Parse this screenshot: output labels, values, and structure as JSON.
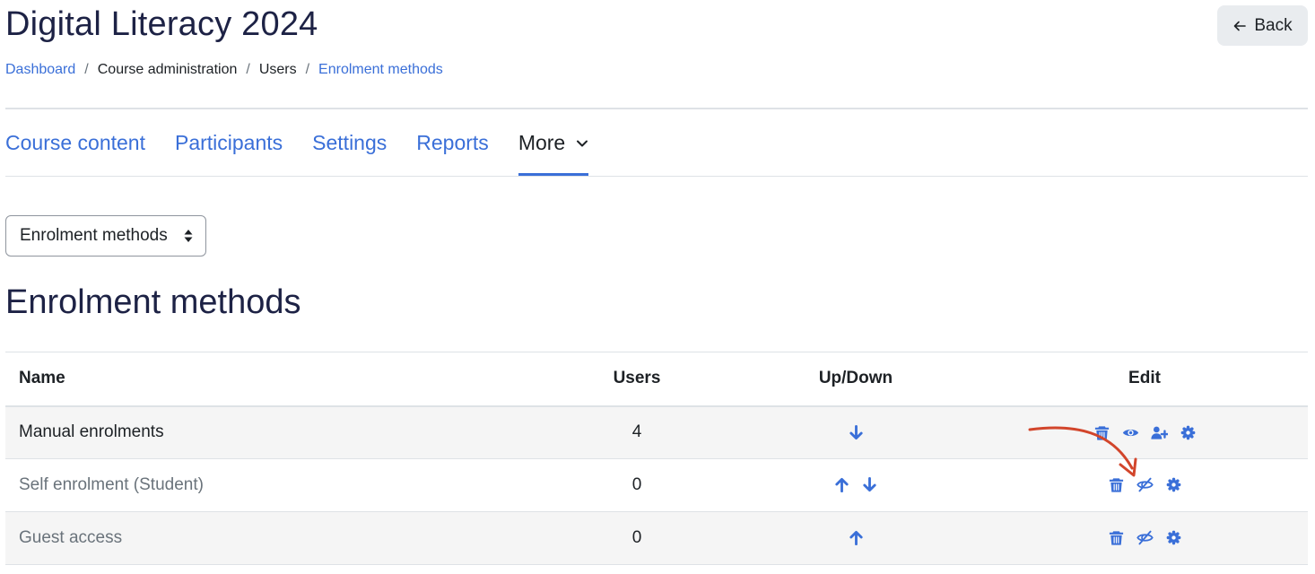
{
  "page": {
    "title": "Digital Literacy 2024",
    "back_label": "Back"
  },
  "breadcrumb": [
    {
      "label": "Dashboard",
      "link": true
    },
    {
      "label": "Course administration",
      "link": false
    },
    {
      "label": "Users",
      "link": false
    },
    {
      "label": "Enrolment methods",
      "link": true
    }
  ],
  "breadcrumb_separator": "/",
  "nav": {
    "tabs": [
      {
        "label": "Course content"
      },
      {
        "label": "Participants"
      },
      {
        "label": "Settings"
      },
      {
        "label": "Reports"
      },
      {
        "label": "More",
        "active": true
      }
    ]
  },
  "selector": {
    "value": "Enrolment methods"
  },
  "section": {
    "title": "Enrolment methods"
  },
  "table": {
    "headers": {
      "name": "Name",
      "users": "Users",
      "updown": "Up/Down",
      "edit": "Edit"
    },
    "rows": [
      {
        "name": "Manual enrolments",
        "users": "4",
        "arrows": [
          "arrow-down-icon"
        ],
        "edit_icons": [
          "trash-icon",
          "eye-icon",
          "enrol-users-icon",
          "gear-icon"
        ]
      },
      {
        "name": "Self enrolment (Student)",
        "users": "0",
        "arrows": [
          "arrow-up-icon",
          "arrow-down-icon"
        ],
        "edit_icons": [
          "trash-icon",
          "eye-slash-icon",
          "gear-icon"
        ]
      },
      {
        "name": "Guest access",
        "users": "0",
        "arrows": [
          "arrow-up-icon"
        ],
        "edit_icons": [
          "trash-icon",
          "eye-slash-icon",
          "gear-icon"
        ]
      }
    ]
  },
  "colors": {
    "link": "#3a6fd8",
    "heading": "#1d2245",
    "annotation": "#d2452b"
  }
}
